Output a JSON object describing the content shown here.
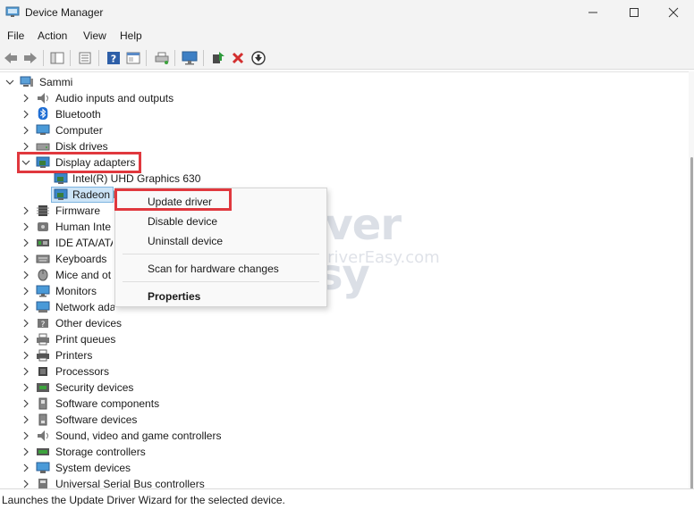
{
  "window": {
    "title": "Device Manager",
    "app_icon": "device-manager-icon"
  },
  "menubar": [
    "File",
    "Action",
    "View",
    "Help"
  ],
  "tree": {
    "root": "Sammi",
    "categories": [
      {
        "label": "Audio inputs and outputs",
        "icon": "speaker-icon"
      },
      {
        "label": "Bluetooth",
        "icon": "bluetooth-icon"
      },
      {
        "label": "Computer",
        "icon": "computer-icon"
      },
      {
        "label": "Disk drives",
        "icon": "disk-drive-icon"
      },
      {
        "label": "Display adapters",
        "icon": "display-adapter-icon",
        "expanded": true
      },
      {
        "label": "Firmware",
        "icon": "firmware-icon"
      },
      {
        "label": "Human Inte",
        "icon": "hid-icon"
      },
      {
        "label": "IDE ATA/ATA",
        "icon": "ide-icon"
      },
      {
        "label": "Keyboards",
        "icon": "keyboard-icon"
      },
      {
        "label": "Mice and ot",
        "icon": "mouse-icon"
      },
      {
        "label": "Monitors",
        "icon": "monitor-icon"
      },
      {
        "label": "Network adapters",
        "icon": "network-icon"
      },
      {
        "label": "Other devices",
        "icon": "other-devices-icon"
      },
      {
        "label": "Print queues",
        "icon": "print-queue-icon"
      },
      {
        "label": "Printers",
        "icon": "printer-icon"
      },
      {
        "label": "Processors",
        "icon": "processor-icon"
      },
      {
        "label": "Security devices",
        "icon": "security-icon"
      },
      {
        "label": "Software components",
        "icon": "software-component-icon"
      },
      {
        "label": "Software devices",
        "icon": "software-device-icon"
      },
      {
        "label": "Sound, video and game controllers",
        "icon": "sound-icon"
      },
      {
        "label": "Storage controllers",
        "icon": "storage-icon"
      },
      {
        "label": "System devices",
        "icon": "system-icon"
      },
      {
        "label": "Universal Serial Bus controllers",
        "icon": "usb-icon"
      }
    ],
    "display_children": [
      {
        "label": "Intel(R) UHD Graphics 630",
        "icon": "display-adapter-icon"
      },
      {
        "label": "Radeon I",
        "icon": "display-adapter-icon",
        "selected": true
      }
    ]
  },
  "context_menu": {
    "items": [
      "Update driver",
      "Disable device",
      "Uninstall device",
      "Scan for hardware changes",
      "Properties"
    ],
    "highlighted": "Update driver"
  },
  "watermark": {
    "brand": "driver easy",
    "url": "www.DriverEasy.com"
  },
  "status_bar": "Launches the Update Driver Wizard for the selected device.",
  "colors": {
    "highlight": "#e0383e",
    "selection": "#cce4f7",
    "accent": "#0067c0"
  }
}
